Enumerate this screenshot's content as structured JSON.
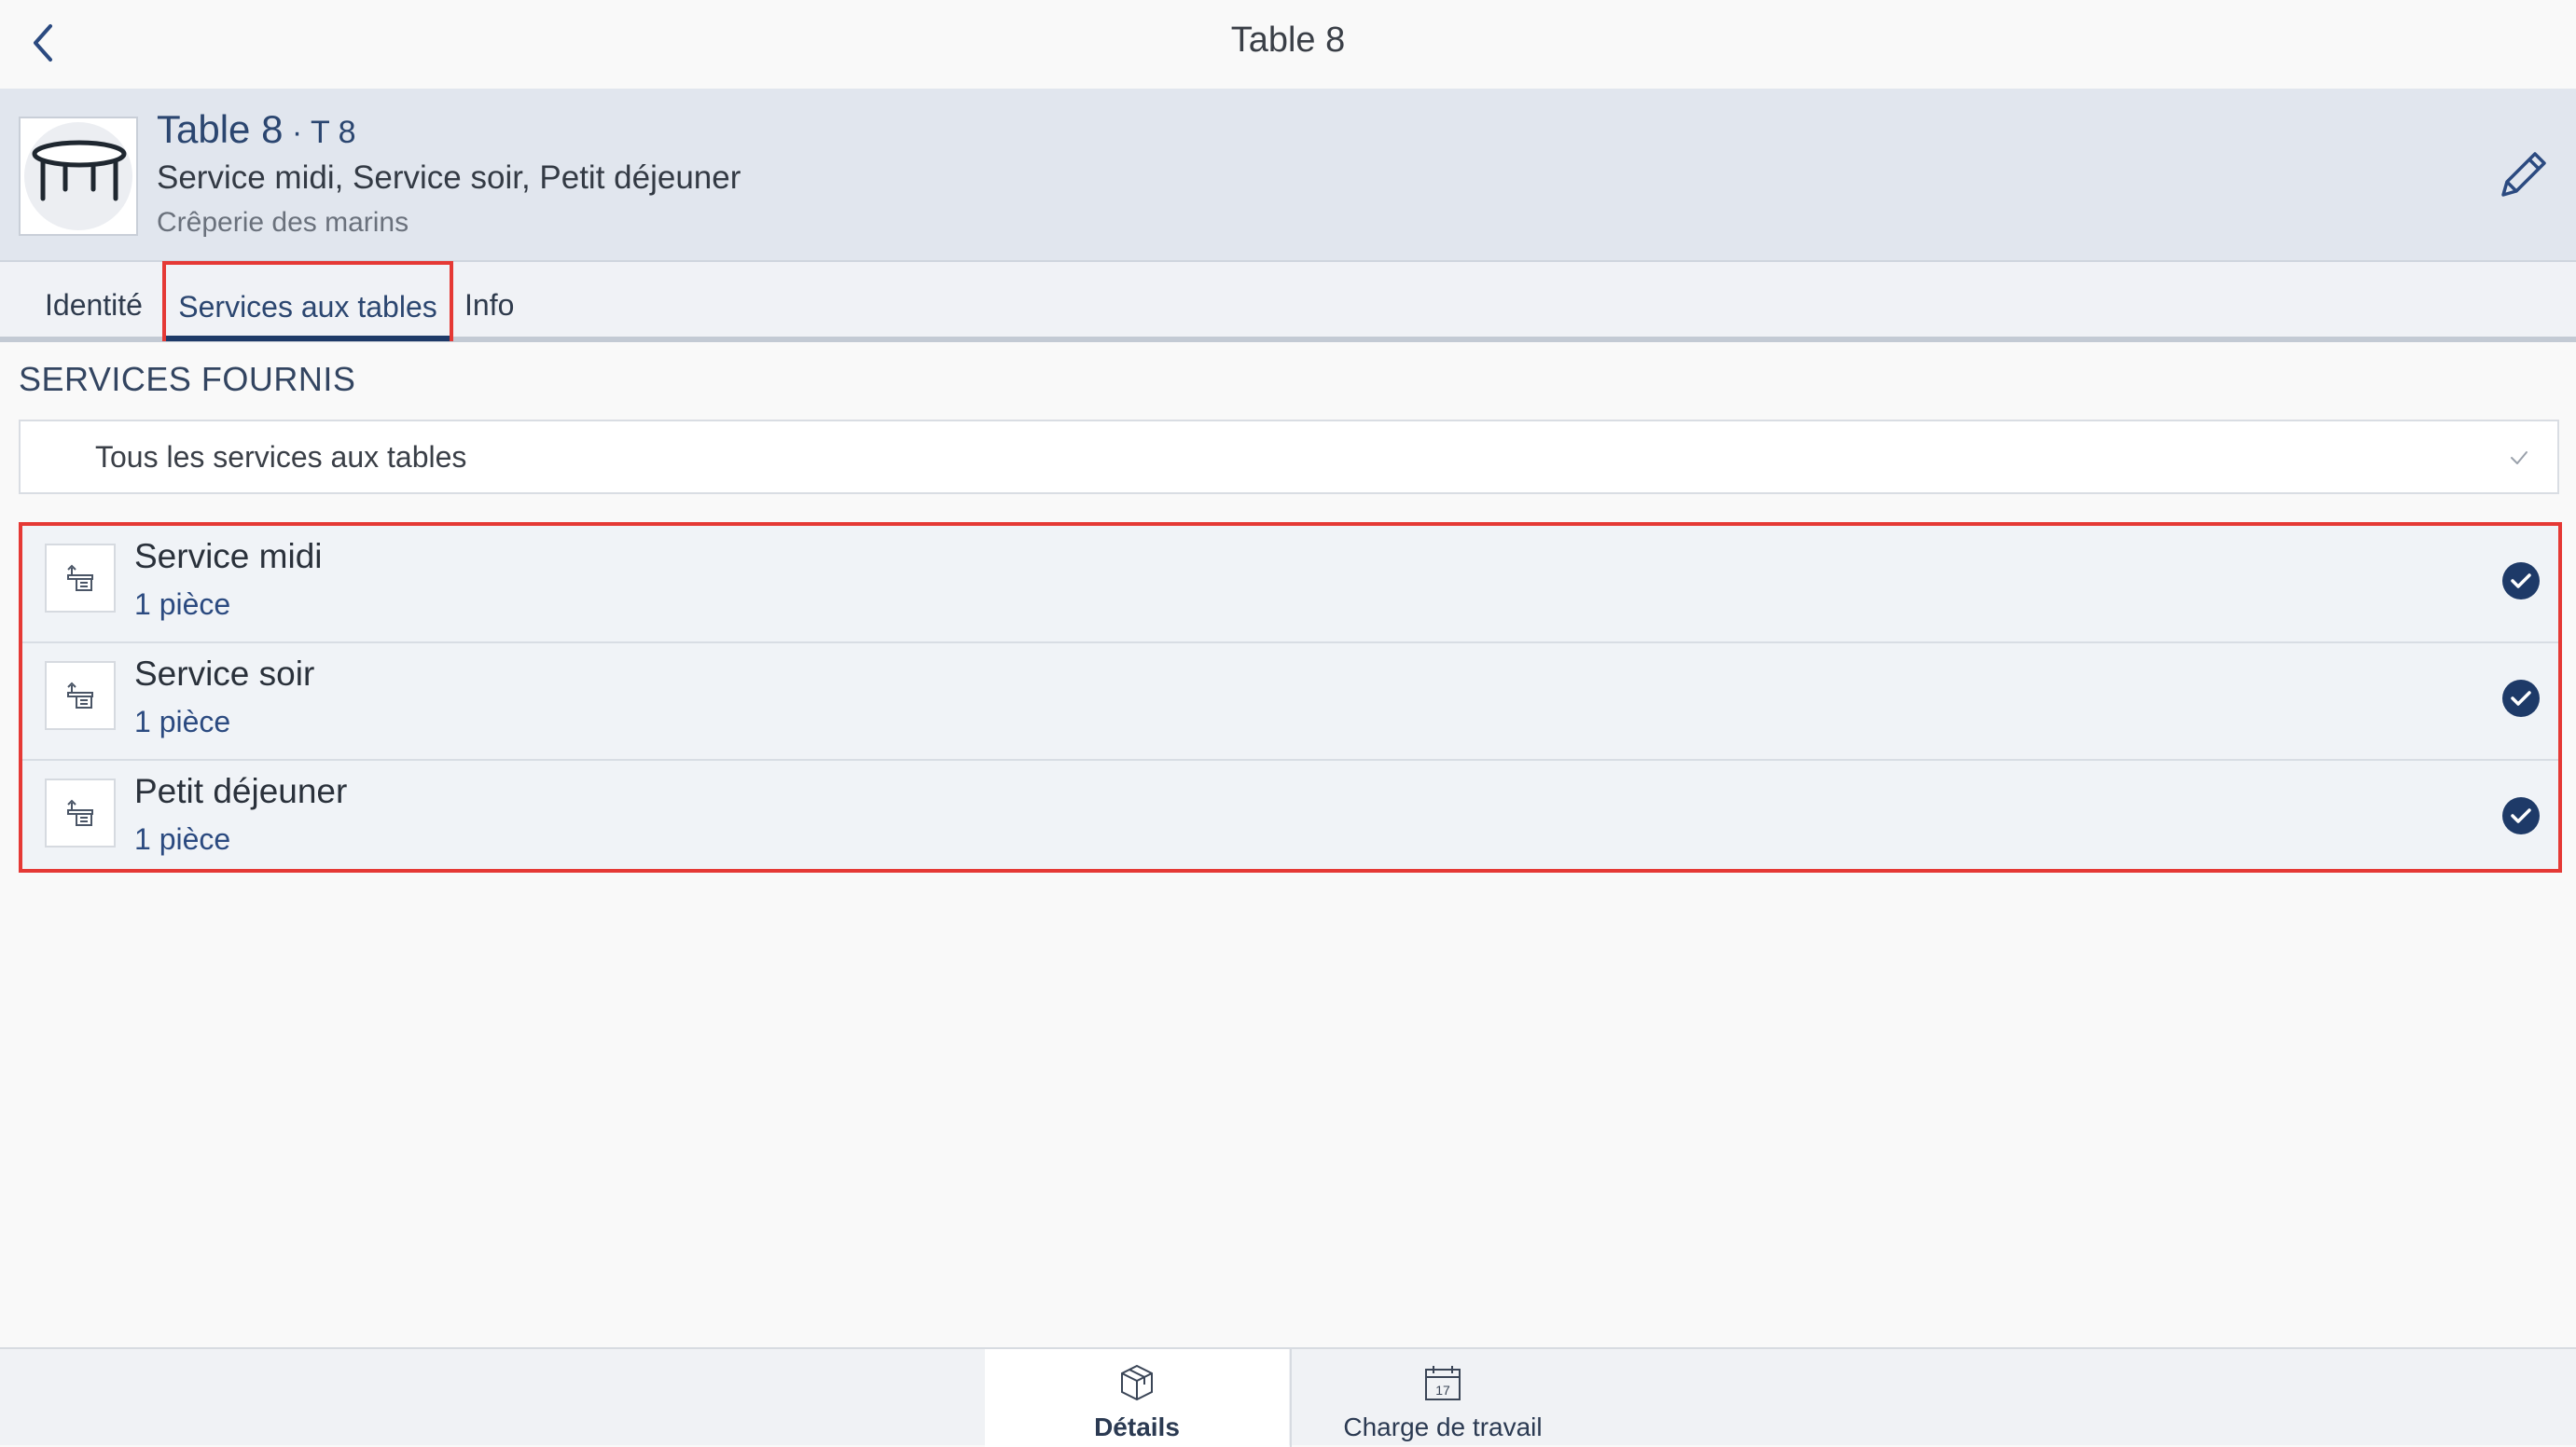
{
  "navbar": {
    "title": "Table 8",
    "back_icon": "chevron-left-icon"
  },
  "header": {
    "name": "Table 8",
    "separator": " · ",
    "code": "T 8",
    "services_summary": "Service midi, Service soir, Petit déjeuner",
    "location": "Crêperie des marins",
    "thumbnail_icon": "round-table-icon",
    "edit_icon": "pencil-icon"
  },
  "tabs": [
    {
      "label": "Identité",
      "active": false
    },
    {
      "label": "Services aux tables",
      "active": true
    },
    {
      "label": "Info",
      "active": false
    }
  ],
  "section": {
    "heading": "SERVICES FOURNIS",
    "filter": {
      "label": "Tous les services aux tables",
      "check_icon": "checkmark-icon"
    }
  },
  "services": [
    {
      "name": "Service midi",
      "quantity": "1 pièce",
      "checked": true,
      "icon": "service-table-icon"
    },
    {
      "name": "Service soir",
      "quantity": "1 pièce",
      "checked": true,
      "icon": "service-table-icon"
    },
    {
      "name": "Petit déjeuner",
      "quantity": "1 pièce",
      "checked": true,
      "icon": "service-table-icon"
    }
  ],
  "bottom_tabs": [
    {
      "label": "Détails",
      "icon": "package-icon",
      "active": true
    },
    {
      "label": "Charge de travail",
      "icon": "calendar-icon",
      "calendar_day": "17",
      "active": false
    }
  ],
  "colors": {
    "accent": "#1e3a68",
    "header_bg": "#e1e6ee",
    "highlight_border": "#e53935",
    "check_fill": "#1e3a68"
  }
}
